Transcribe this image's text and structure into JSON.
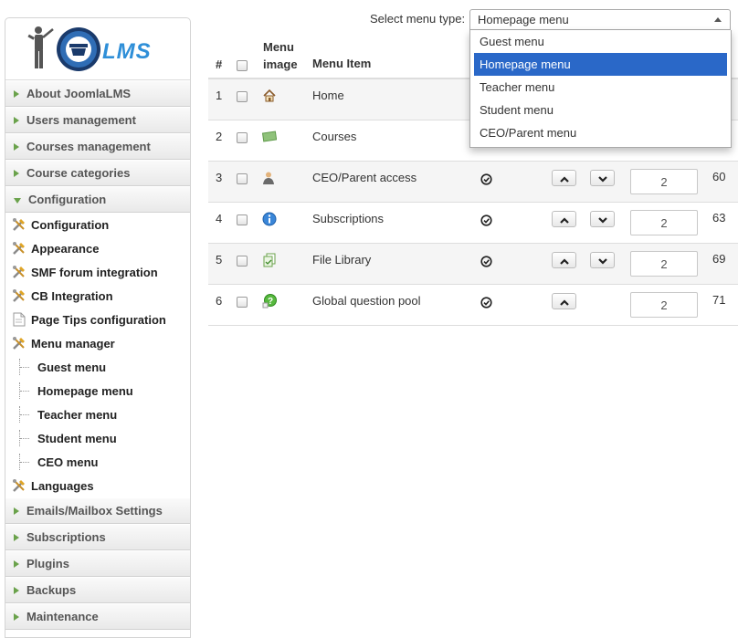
{
  "sidebar": {
    "sections_top": [
      {
        "label": "About JoomlaLMS"
      },
      {
        "label": "Users management"
      },
      {
        "label": "Courses management"
      },
      {
        "label": "Course categories"
      }
    ],
    "open_section": {
      "label": "Configuration"
    },
    "items": [
      {
        "label": "Configuration",
        "icon": "tools-icon"
      },
      {
        "label": "Appearance",
        "icon": "tools-icon"
      },
      {
        "label": "SMF forum integration",
        "icon": "tools-icon"
      },
      {
        "label": "CB Integration",
        "icon": "tools-icon"
      },
      {
        "label": "Page Tips configuration",
        "icon": "document-icon"
      },
      {
        "label": "Menu manager",
        "icon": "tools-icon"
      }
    ],
    "menu_children": [
      {
        "label": "Guest menu"
      },
      {
        "label": "Homepage menu"
      },
      {
        "label": "Teacher menu"
      },
      {
        "label": "Student menu"
      },
      {
        "label": "CEO menu"
      }
    ],
    "languages": {
      "label": "Languages",
      "icon": "tools-icon"
    },
    "sections_bottom": [
      {
        "label": "Emails/Mailbox Settings"
      },
      {
        "label": "Subscriptions"
      },
      {
        "label": "Plugins"
      },
      {
        "label": "Backups"
      },
      {
        "label": "Maintenance"
      }
    ]
  },
  "menu_type": {
    "label": "Select menu type:",
    "selected": "Homepage menu",
    "options": [
      "Guest menu",
      "Homepage menu",
      "Teacher menu",
      "Student menu",
      "CEO/Parent menu"
    ]
  },
  "table": {
    "headers": {
      "num": "#",
      "image_line1": "Menu",
      "image_line2": "image",
      "item": "Menu Item"
    },
    "rows": [
      {
        "num": "1",
        "icon": "home-icon",
        "item": "Home",
        "published": true,
        "up": false,
        "down": false,
        "order": "",
        "id": ""
      },
      {
        "num": "2",
        "icon": "courses-icon",
        "item": "Courses",
        "published": false,
        "up": false,
        "down": false,
        "order": "",
        "id": ""
      },
      {
        "num": "3",
        "icon": "user-icon",
        "item": "CEO/Parent access",
        "published": true,
        "up": true,
        "down": true,
        "order": "2",
        "id": "60"
      },
      {
        "num": "4",
        "icon": "info-icon",
        "item": "Subscriptions",
        "published": true,
        "up": true,
        "down": true,
        "order": "2",
        "id": "63"
      },
      {
        "num": "5",
        "icon": "file-library-icon",
        "item": "File Library",
        "published": true,
        "up": true,
        "down": true,
        "order": "2",
        "id": "69"
      },
      {
        "num": "6",
        "icon": "question-icon",
        "item": "Global question pool",
        "published": true,
        "up": true,
        "down": false,
        "order": "2",
        "id": "71"
      }
    ]
  },
  "colors": {
    "selected_option": "#2a68c8",
    "section_arrow": "#6aa24b",
    "row_stripe": "#f5f5f5"
  }
}
